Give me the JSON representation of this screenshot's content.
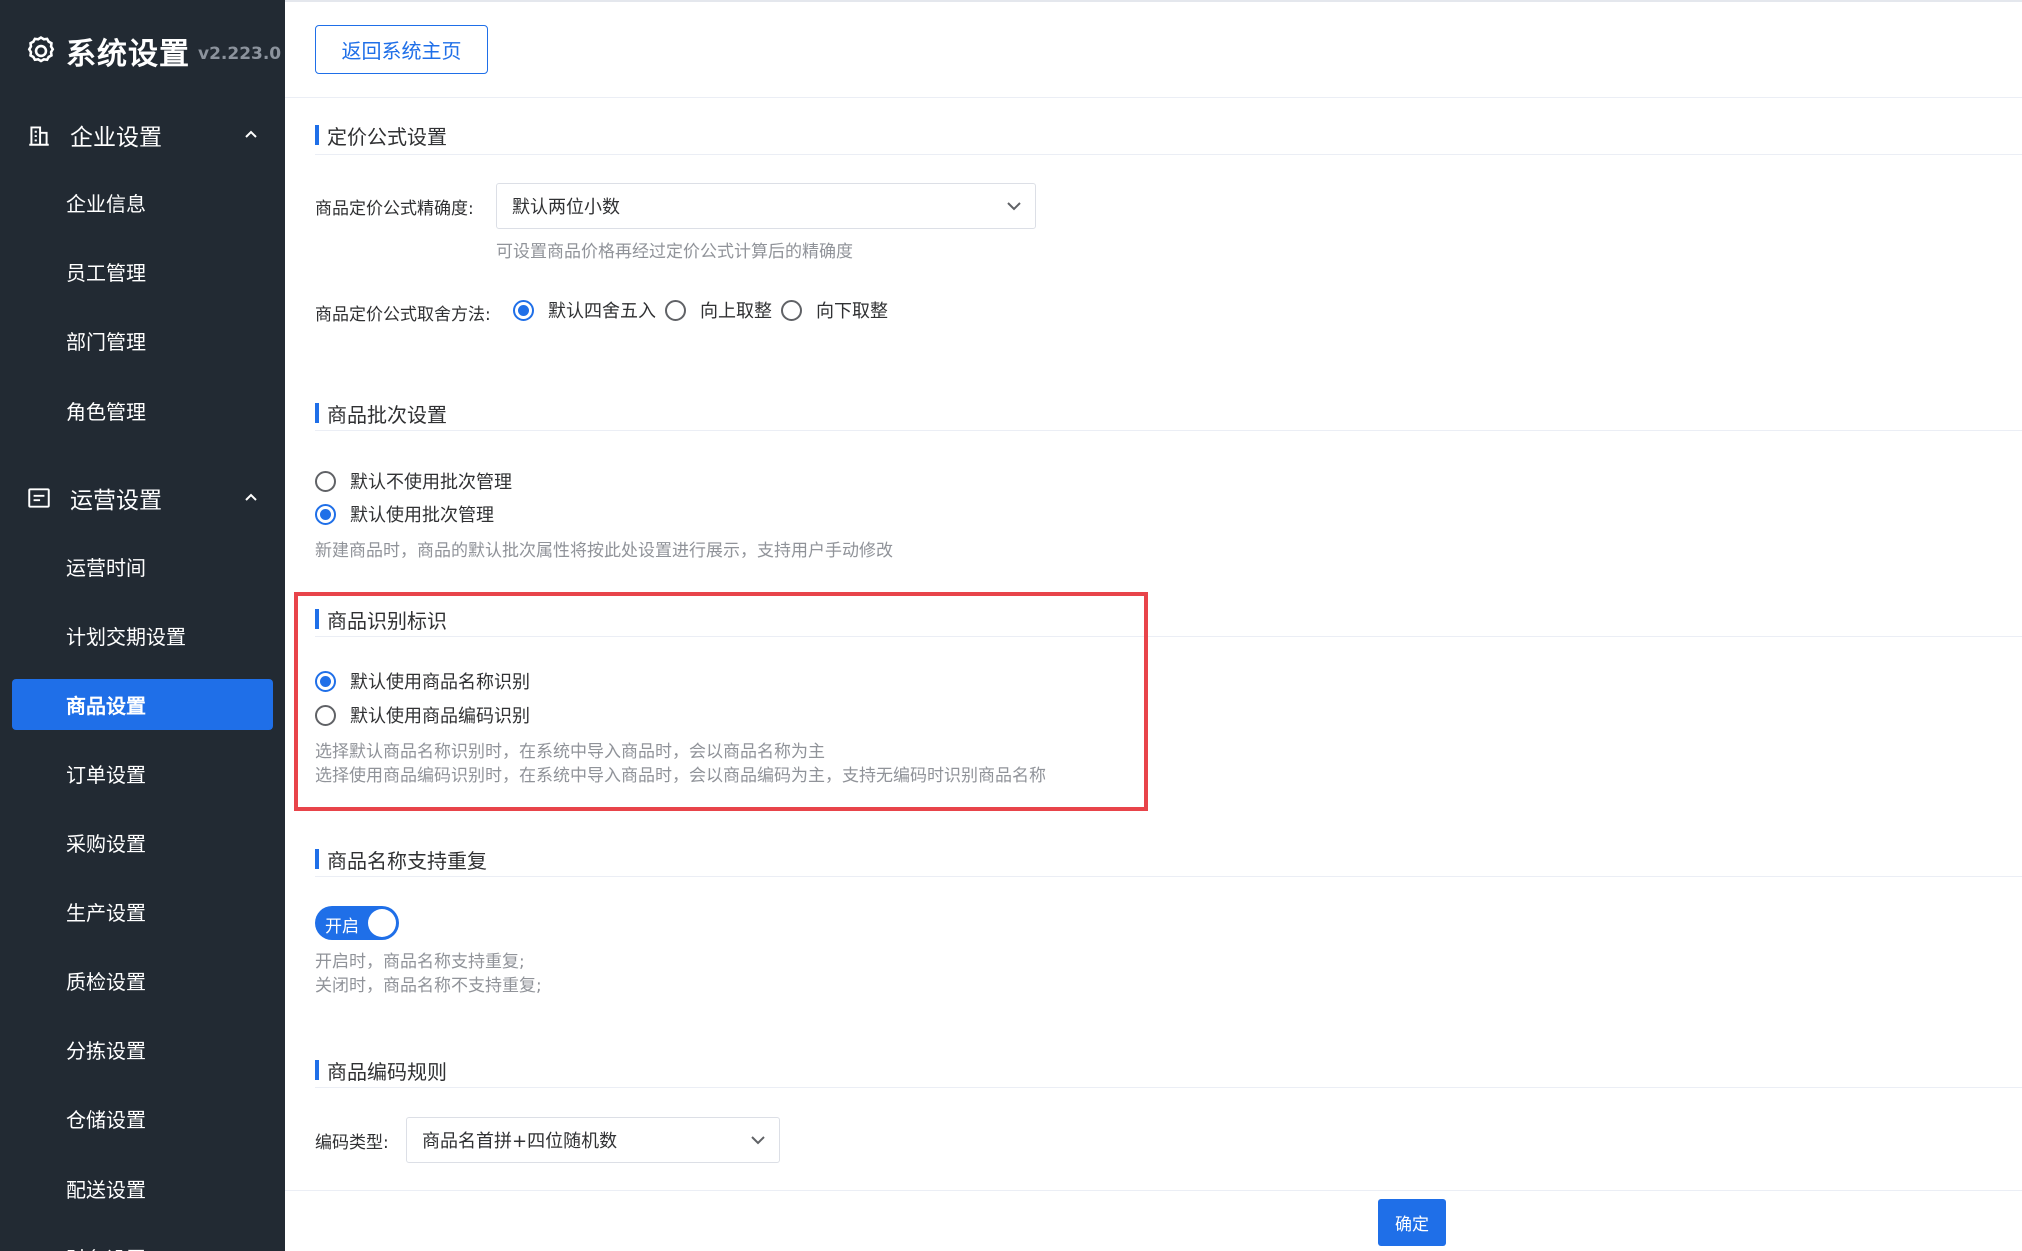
{
  "sidebar": {
    "title": "系统设置",
    "version": "v2.223.0",
    "groups": [
      {
        "label": "企业设置",
        "items": [
          "企业信息",
          "员工管理",
          "部门管理",
          "角色管理"
        ]
      },
      {
        "label": "运营设置",
        "items": [
          "运营时间",
          "计划交期设置",
          "商品设置",
          "订单设置",
          "采购设置",
          "生产设置",
          "质检设置",
          "分拣设置",
          "仓储设置",
          "配送设置",
          "财务设置"
        ]
      }
    ],
    "active_item": "商品设置"
  },
  "header": {
    "back_button": "返回系统主页"
  },
  "sections": {
    "pricing": {
      "title": "定价公式设置",
      "precision_label": "商品定价公式精确度:",
      "precision_value": "默认两位小数",
      "precision_hint": "可设置商品价格再经过定价公式计算后的精确度",
      "rounding_label": "商品定价公式取舍方法:",
      "rounding_options": [
        "默认四舍五入",
        "向上取整",
        "向下取整"
      ],
      "rounding_selected": "默认四舍五入"
    },
    "batch": {
      "title": "商品批次设置",
      "options": [
        "默认不使用批次管理",
        "默认使用批次管理"
      ],
      "selected": "默认使用批次管理",
      "hint": "新建商品时，商品的默认批次属性将按此处设置进行展示，支持用户手动修改"
    },
    "identify": {
      "title": "商品识别标识",
      "options": [
        "默认使用商品名称识别",
        "默认使用商品编码识别"
      ],
      "selected": "默认使用商品名称识别",
      "hint_1": "选择默认商品名称识别时，在系统中导入商品时，会以商品名称为主",
      "hint_2": "选择使用商品编码识别时，在系统中导入商品时，会以商品编码为主，支持无编码时识别商品名称"
    },
    "duplicate": {
      "title": "商品名称支持重复",
      "toggle_label": "开启",
      "toggle_on": true,
      "hint_1": "开启时，商品名称支持重复;",
      "hint_2": "关闭时，商品名称不支持重复;"
    },
    "code_rule": {
      "title": "商品编码规则",
      "type_label": "编码类型:",
      "type_value": "商品名首拼+四位随机数"
    }
  },
  "footer": {
    "confirm_button": "确定"
  },
  "colors": {
    "sidebar_bg": "#222a33",
    "accent": "#1f6fe8",
    "highlight": "#e8444a"
  }
}
